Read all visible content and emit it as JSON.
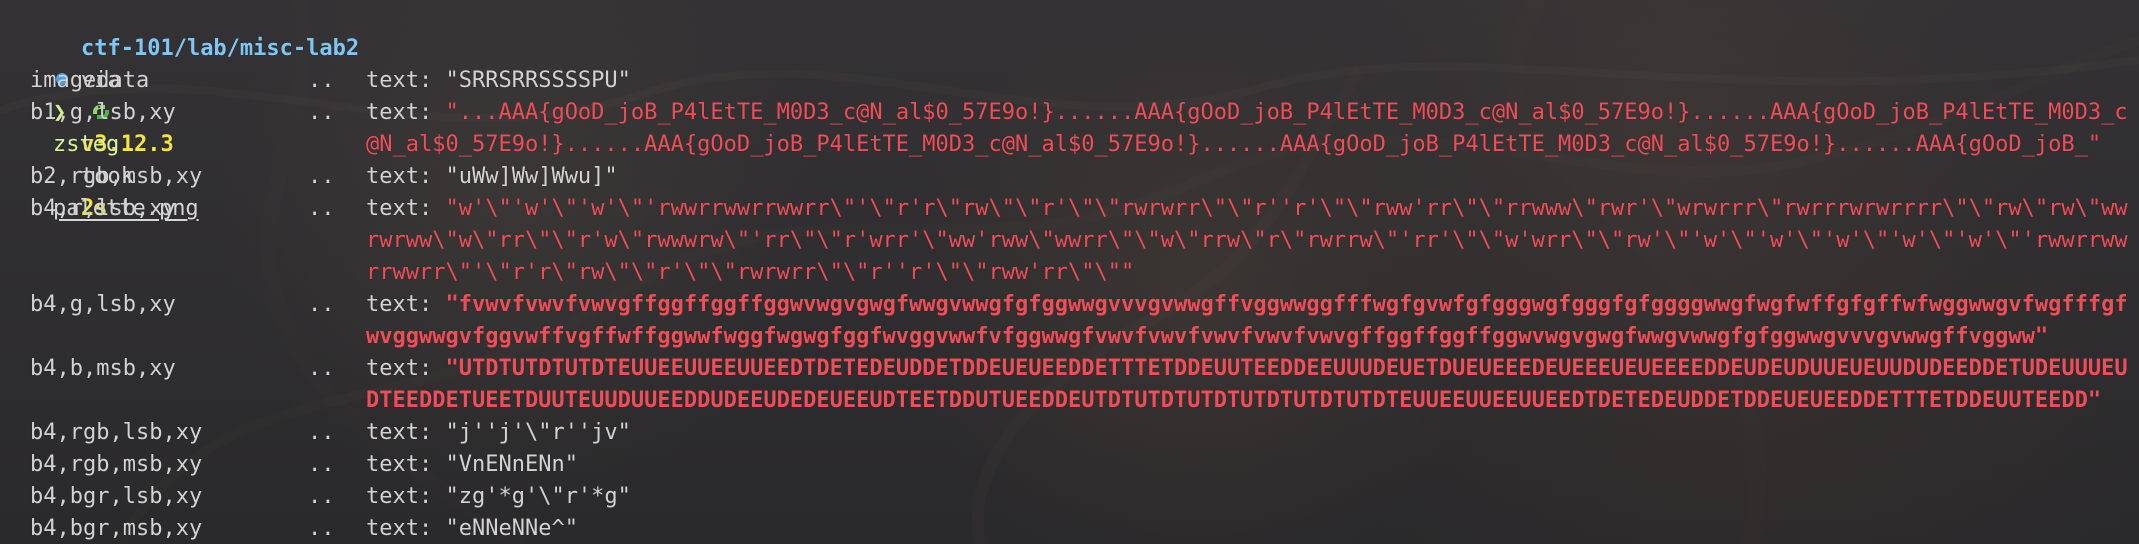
{
  "window": {
    "prompt": {
      "path": "ctf-101/lab/misc-lab2",
      "via": "via",
      "version": "v3.12.3",
      "took": "took",
      "duration": "2s"
    },
    "command": {
      "name": "zsteg",
      "file": "palette.png"
    },
    "rows": [
      {
        "label": "imagedata",
        "separator": "..",
        "prefix": "text:",
        "value": "\"SRRSRRSSSSPU\"",
        "style": "plain"
      },
      {
        "label": "b1,g,lsb,xy",
        "separator": "..",
        "prefix": "text:",
        "value": "\"...AAA{gOoD_joB_P4lEtTE_M0D3_c@N_al$0_57E9o!}......AAA{gOoD_joB_P4lEtTE_M0D3_c@N_al$0_57E9o!}......AAA{gOoD_joB_P4lEtTE_M0D3_c@N_al$0_57E9o!}......AAA{gOoD_joB_P4lEtTE_M0D3_c@N_al$0_57E9o!}......AAA{gOoD_joB_P4lEtTE_M0D3_c@N_al$0_57E9o!}......AAA{gOoD_joB_\"",
        "style": "red"
      },
      {
        "label": "b2,rgb,msb,xy",
        "separator": "..",
        "prefix": "text:",
        "value": "\"uWw]Ww]Wwu]\"",
        "style": "plain"
      },
      {
        "label": "b4,r,lsb,xy",
        "separator": "..",
        "prefix": "text:",
        "value": "\"w'\\\"'w'\\\"'w'\\\"'rwwrrwwrrwwrr\\\"'\\\"r'r\\\"rw\\\"\\\"r'\\\"\\\"rwrwrr\\\"\\\"r''r'\\\"\\\"rww'rr\\\"\\\"rrwww\\\"rwr'\\\"wrwrrr\\\"rwrrrwrwrrrr\\\"\\\"rw\\\"rw\\\"wwrwrww\\\"w\\\"rr\\\"\\\"r'w\\\"rwwwrw\\\"'rr\\\"\\\"r'wrr'\\\"ww'rww\\\"wwrr\\\"\\\"w\\\"rrw\\\"r\\\"rwrrw\\\"'rr'\\\"\\\"w'wrr\\\"\\\"rw'\\\"'w'\\\"'w'\\\"'w'\\\"'w'\\\"'w'\\\"'rwwrrwwrrwwrr\\\"'\\\"r'r\\\"rw\\\"\\\"r'\\\"\\\"rwrwrr\\\"\\\"r''r'\\\"\\\"rww'rr\\\"\\\"\"",
        "style": "red"
      },
      {
        "label": "b4,g,lsb,xy",
        "separator": "..",
        "prefix": "text:",
        "value": "\"fvwvfvwvfvwvgffggffggffggwvwgvgwgfwwgvwwgfgfggwwgvvvgvwwgffvggwwggfffwgfgvwfgfgggwgfgggfgfggggwwgfwgfwffgfgffwfwggwwgvfwgfffgfwvggwwgvfggvwffvgffwffggwwfwggfwgwgfggfwvggvwwfvfggwwgfvwvfvwvfvwvfvwvfvwvgffggffggffggwvwgvgwgfwwgvwwgfgfggwwgvvvgvwwgffvggww\"",
        "style": "bold-red"
      },
      {
        "label": "b4,b,msb,xy",
        "separator": "..",
        "prefix": "text:",
        "value": "\"UTDTUTDTUTDTEUUEEUUEEUUEEDTDETEDEUDDETDDEUEUEEDDETTTETDDEUUTEEDDEEUUUDEUETDUEUEEEDEUEEEUEUEEEEDDEUDEUDUUEUEUUDUDEEDDETUDEUUUEUDTEEDDETUEETDUUTEUUDUUEEDDUDEEUDEDEUEEUDTEETDDUTUEEDDEUTDTUTDTUTDTUTDTUTDTUTDTEUUEEUUEEUUEEDTDETEDEUDDETDDEUEUEEDDETTTETDDEUUTEEDD\"",
        "style": "bold-red"
      },
      {
        "label": "b4,rgb,lsb,xy",
        "separator": "..",
        "prefix": "text:",
        "value": "\"j''j'\\\"r''jv\"",
        "style": "plain"
      },
      {
        "label": "b4,rgb,msb,xy",
        "separator": "..",
        "prefix": "text:",
        "value": "\"VnENnENn\"",
        "style": "plain"
      },
      {
        "label": "b4,bgr,lsb,xy",
        "separator": "..",
        "prefix": "text:",
        "value": "\"zg'*g'\\\"r'*g\"",
        "style": "plain"
      },
      {
        "label": "b4,bgr,msb,xy",
        "separator": "..",
        "prefix": "text:",
        "value": "\"eNNeNNe^\"",
        "style": "plain"
      }
    ]
  }
}
